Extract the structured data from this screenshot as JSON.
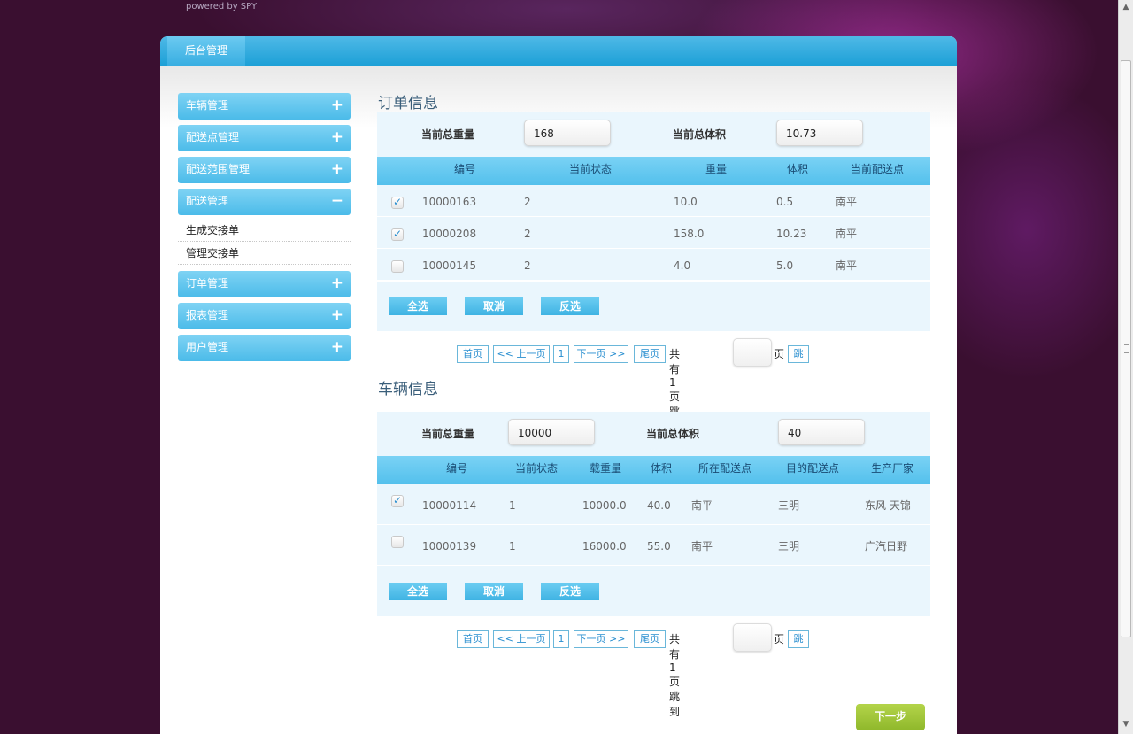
{
  "header": {
    "powered_by": "powered by SPY"
  },
  "panel": {
    "tab_label": "后台管理"
  },
  "sidebar": {
    "items": [
      {
        "label": "车辆管理",
        "sign": "+"
      },
      {
        "label": "配送点管理",
        "sign": "+"
      },
      {
        "label": "配送范围管理",
        "sign": "+"
      },
      {
        "label": "配送管理",
        "sign": "−"
      },
      {
        "label": "订单管理",
        "sign": "+"
      },
      {
        "label": "报表管理",
        "sign": "+"
      },
      {
        "label": "用户管理",
        "sign": "+"
      }
    ],
    "sub_items": [
      "生成交接单",
      "管理交接单"
    ]
  },
  "orders": {
    "title": "订单信息",
    "total_weight_label": "当前总重量",
    "total_weight": "168",
    "total_volume_label": "当前总体积",
    "total_volume": "10.73",
    "columns": [
      "编号",
      "当前状态",
      "重量",
      "体积",
      "当前配送点"
    ],
    "rows": [
      {
        "checked": true,
        "id": "10000163",
        "status": "2",
        "weight": "10.0",
        "volume": "0.5",
        "point": "南平"
      },
      {
        "checked": true,
        "id": "10000208",
        "status": "2",
        "weight": "158.0",
        "volume": "10.23",
        "point": "南平"
      },
      {
        "checked": false,
        "id": "10000145",
        "status": "2",
        "weight": "4.0",
        "volume": "5.0",
        "point": "南平"
      }
    ],
    "buttons": {
      "select_all": "全选",
      "cancel": "取消",
      "invert": "反选"
    }
  },
  "vehicles": {
    "title": "车辆信息",
    "total_weight_label": "当前总重量",
    "total_weight": "10000",
    "total_volume_label": "当前总体积",
    "total_volume": "40",
    "columns": [
      "编号",
      "当前状态",
      "载重量",
      "体积",
      "所在配送点",
      "目的配送点",
      "生产厂家"
    ],
    "rows": [
      {
        "checked": true,
        "id": "10000114",
        "status": "1",
        "capacity": "10000.0",
        "volume": "40.0",
        "location": "南平",
        "destination": "三明",
        "maker": "东风 天锦"
      },
      {
        "checked": false,
        "id": "10000139",
        "status": "1",
        "capacity": "16000.0",
        "volume": "55.0",
        "location": "南平",
        "destination": "三明",
        "maker": "广汽日野"
      }
    ],
    "buttons": {
      "select_all": "全选",
      "cancel": "取消",
      "invert": "反选"
    }
  },
  "pager": {
    "first": "首页",
    "prev": "<< 上一页",
    "page": "1",
    "next": "下一页 >>",
    "last": "尾页",
    "total": "共有1页 跳到",
    "page_suffix": "页",
    "jump": "跳"
  },
  "next_step": "下一步",
  "colors": {
    "accent": "#4bbbe9",
    "table_bg": "#eaf6fd",
    "next_button": "#a3c83a"
  }
}
